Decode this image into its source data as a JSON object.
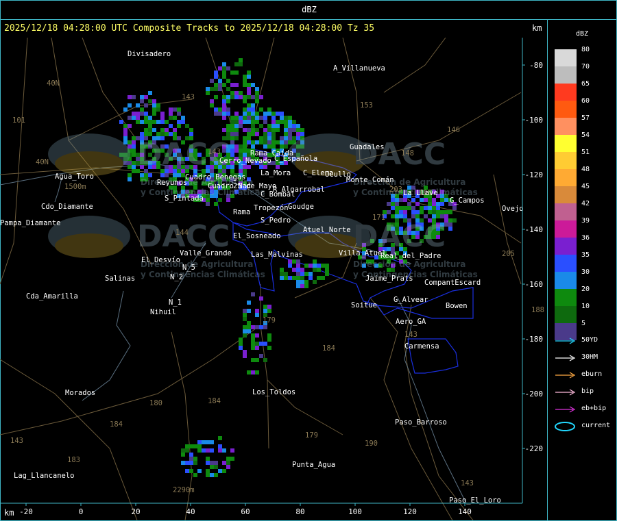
{
  "header": {
    "unit_label": "dBZ"
  },
  "map": {
    "title": "2025/12/18 04:28:00 UTC Composite Tracks to 2025/12/18 04:28:00 Tz 35",
    "km_label_top": "km",
    "km_label_bottom": "km",
    "x_ticks": [
      "-20",
      "0",
      "20",
      "40",
      "60",
      "80",
      "100",
      "120",
      "140"
    ],
    "y_ticks": [
      "-80",
      "-100",
      "-120",
      "-140",
      "-160",
      "-180",
      "-200",
      "-220"
    ],
    "places": [
      "Divisadero",
      "A_Villanueva",
      "Guadales",
      "Ucullo",
      "Monte_Comán",
      "G_Campos",
      "Ovejo",
      "C_Elena",
      "La_Llave",
      "C_Española",
      "Cerro_Nevado",
      "La_Mora",
      "Rama_Caída",
      "C_Bombal",
      "R_Algarrobal",
      "Tropezón",
      "Goudge",
      "S_Pintada",
      "Rama",
      "S_Pedro",
      "25_de_Mayo",
      "Cuadro_Nac",
      "Cuadro_Benegas",
      "El_Sosneado",
      "Reyunos",
      "Agua_Toro",
      "Pampa_Diamante",
      "El_Desvío",
      "Salinas",
      "Valle_Grande",
      "N_5",
      "N_2",
      "N_1",
      "Cda_Amarilla",
      "Nihuil",
      "Jaime_Prats",
      "Las_Malvinas",
      "Villa_Atuel",
      "Atuel_Norte",
      "Real_del_Padre",
      "Soitue",
      "G_Alvear",
      "CompantEscard",
      "Bowen",
      "Aero_GA",
      "Carmensa",
      "Los_Toldos",
      "Morados",
      "Paso_Barroso",
      "Punta_Agua",
      "Lag_Llancanelo",
      "Paso_El_Loro",
      "Cdo_Diamante"
    ],
    "altitude_labels": [
      "1500m",
      "2290m"
    ],
    "road_numbers": [
      "101",
      "40N",
      "40N",
      "153",
      "146",
      "143",
      "143",
      "144",
      "148",
      "171",
      "203",
      "188",
      "180",
      "184",
      "184",
      "183",
      "179",
      "179",
      "184",
      "190",
      "143",
      "143",
      "205",
      "188",
      "143"
    ],
    "watermark_brand": "DACC",
    "watermark_line1": "Dirección de Agricultura",
    "watermark_line2": "y Contingencias Climáticas"
  },
  "legend": {
    "title": "dBZ",
    "scale": [
      {
        "value": "80",
        "color": "#d9d9d9"
      },
      {
        "value": "70",
        "color": "#bdbdbd"
      },
      {
        "value": "65",
        "color": "#ff3a1f"
      },
      {
        "value": "60",
        "color": "#ff5a10"
      },
      {
        "value": "57",
        "color": "#ff9060"
      },
      {
        "value": "54",
        "color": "#ffff30"
      },
      {
        "value": "51",
        "color": "#ffcc33"
      },
      {
        "value": "48",
        "color": "#ffaa33"
      },
      {
        "value": "45",
        "color": "#d98a3a"
      },
      {
        "value": "42",
        "color": "#c06090"
      },
      {
        "value": "39",
        "color": "#cc1a99"
      },
      {
        "value": "36",
        "color": "#7a1fd0"
      },
      {
        "value": "35",
        "color": "#2a4fff"
      },
      {
        "value": "30",
        "color": "#1a8ae8"
      },
      {
        "value": "20",
        "color": "#0e8a0e"
      },
      {
        "value": "10",
        "color": "#0e6a0e"
      },
      {
        "value": "5",
        "color": "#4a3a8a"
      }
    ],
    "tracks": [
      {
        "label": "50YD",
        "color": "#22d8ff"
      },
      {
        "label": "30HM",
        "color": "#ffffff"
      },
      {
        "label": "eburn",
        "color": "#ffaa44"
      },
      {
        "label": "bip",
        "color": "#ffbbdd"
      },
      {
        "label": "eb+bip",
        "color": "#dd33dd"
      },
      {
        "label": "current",
        "color": "#22d8ff"
      }
    ]
  }
}
